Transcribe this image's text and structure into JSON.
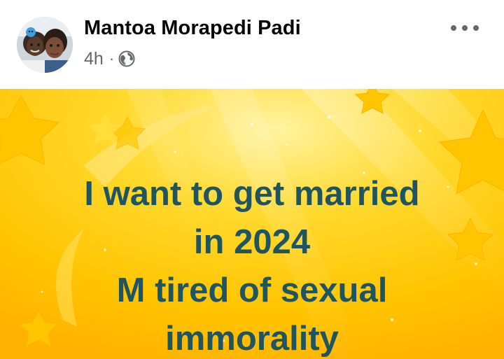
{
  "post": {
    "author_name": "Mantoa Morapedi Padi",
    "timestamp": "4h",
    "separator": "·",
    "audience_icon": "globe-icon",
    "more_icon": "more-options-icon",
    "content_lines": [
      "I want to get married",
      "in 2024",
      "M tired of sexual",
      "immorality"
    ],
    "colors": {
      "text_dark": "#1e5560",
      "background_yellow": "#ffc700",
      "meta_gray": "#65676b"
    }
  }
}
